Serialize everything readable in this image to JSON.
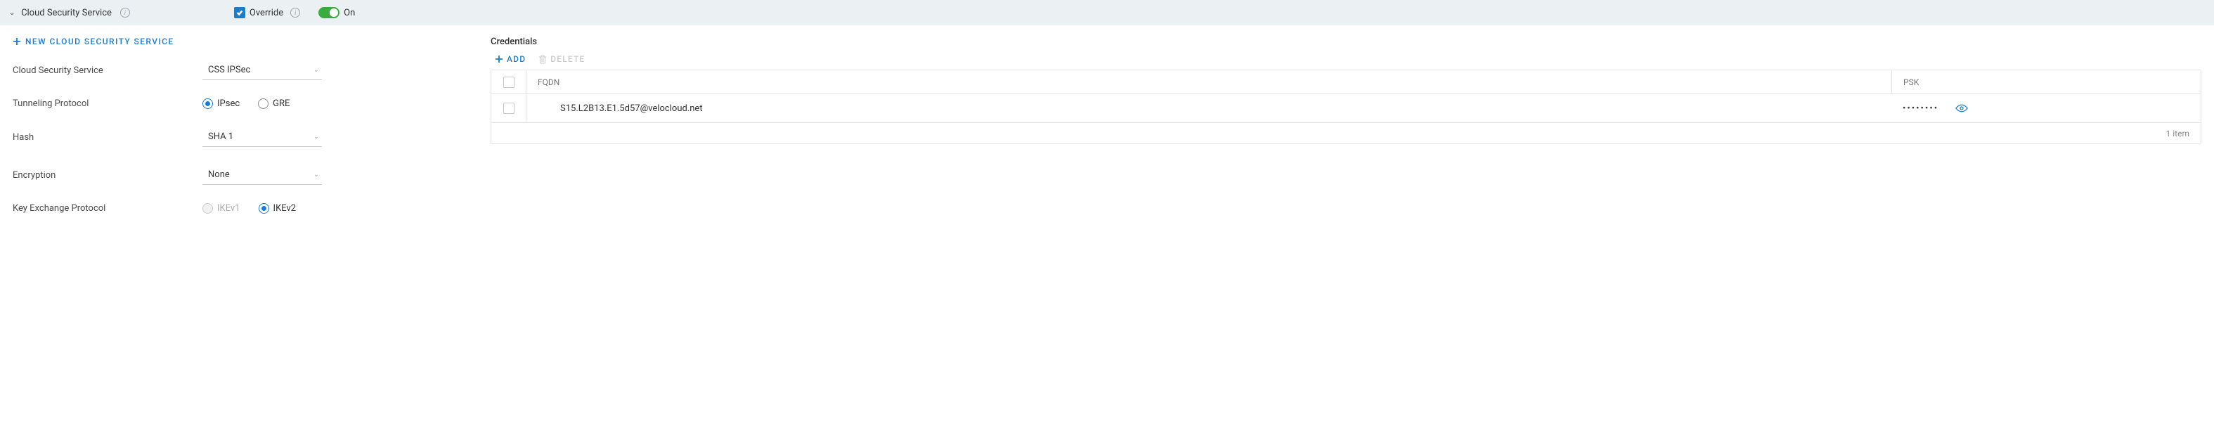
{
  "header": {
    "title": "Cloud Security Service",
    "override_label": "Override",
    "toggle_label": "On"
  },
  "left": {
    "new_btn": "NEW CLOUD SECURITY SERVICE",
    "css_label": "Cloud Security Service",
    "css_value": "CSS IPSec",
    "tunnel_label": "Tunneling Protocol",
    "radio_ipsec": "IPsec",
    "radio_gre": "GRE",
    "hash_label": "Hash",
    "hash_value": "SHA 1",
    "enc_label": "Encryption",
    "enc_value": "None",
    "kex_label": "Key Exchange Protocol",
    "radio_ikev1": "IKEv1",
    "radio_ikev2": "IKEv2"
  },
  "cred": {
    "title": "Credentials",
    "add": "ADD",
    "delete": "DELETE",
    "col_fqdn": "FQDN",
    "col_psk": "PSK",
    "rows": [
      {
        "fqdn": "S15.L2B13.E1.5d57@velocloud.net",
        "psk": "••••••••"
      }
    ],
    "footer": "1 item"
  }
}
